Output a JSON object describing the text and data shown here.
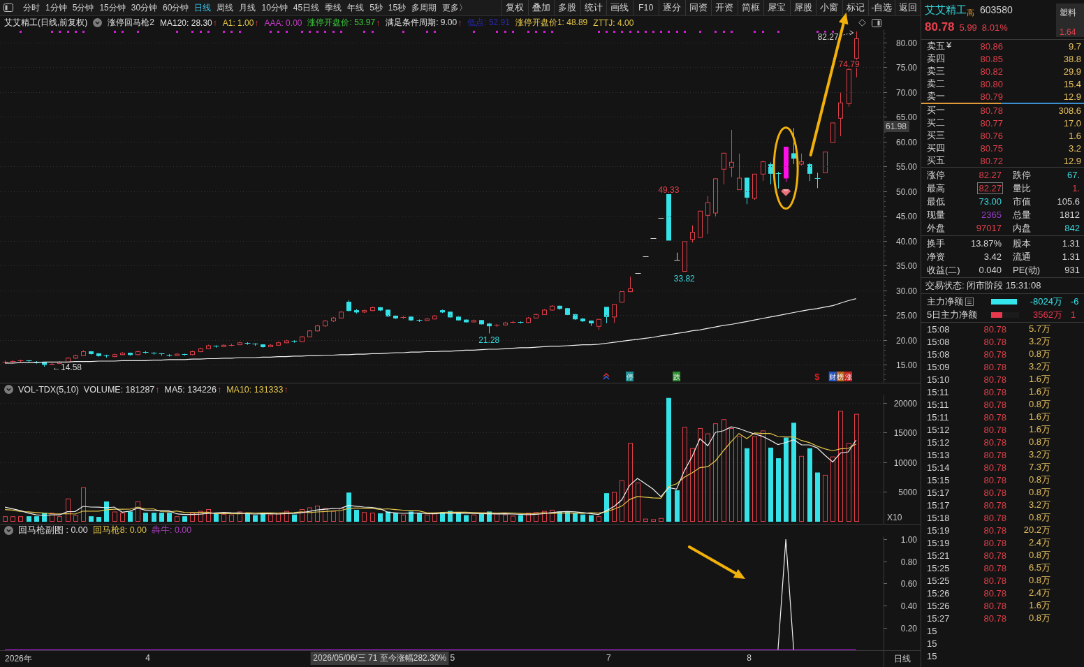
{
  "toolbar": {
    "periods": [
      {
        "label": "分时",
        "selected": false
      },
      {
        "label": "1分钟",
        "selected": false
      },
      {
        "label": "5分钟",
        "selected": false
      },
      {
        "label": "15分钟",
        "selected": false
      },
      {
        "label": "30分钟",
        "selected": false
      },
      {
        "label": "60分钟",
        "selected": false
      },
      {
        "label": "日线",
        "selected": true
      },
      {
        "label": "周线",
        "selected": false
      },
      {
        "label": "月线",
        "selected": false
      },
      {
        "label": "10分钟",
        "selected": false
      },
      {
        "label": "45日线",
        "selected": false
      },
      {
        "label": "季线",
        "selected": false
      },
      {
        "label": "年线",
        "selected": false
      },
      {
        "label": "5秒",
        "selected": false
      },
      {
        "label": "15秒",
        "selected": false
      },
      {
        "label": "多周期",
        "selected": false
      },
      {
        "label": "更多〉",
        "selected": false
      }
    ],
    "buttons": [
      "复权",
      "叠加",
      "多股",
      "统计",
      "画线",
      "F10",
      "逐分",
      "同资",
      "开资",
      "简框",
      "犀宝",
      "犀股",
      "小窗",
      "标记",
      "-自选",
      "返回"
    ]
  },
  "info_bar": {
    "title": "艾艾精工(日线,前复权)",
    "indicator": "涨停回马枪2",
    "values": [
      {
        "text": "MA120: 28.30",
        "arrow": "↑",
        "color": "#e0e0e0"
      },
      {
        "text": "A1: 1.00",
        "arrow": "↑",
        "color": "#e6c84a"
      },
      {
        "text": "AAA: 0.00",
        "color": "#c83cc8"
      },
      {
        "text": "涨停开盘价: 53.97",
        "arrow": "↑",
        "color": "#3cc83c"
      },
      {
        "text": "满足条件周期: 9.00",
        "arrow": "↑",
        "color": "#e0e0e0"
      },
      {
        "text": "低点: 52.91",
        "color": "#2a2ab4"
      },
      {
        "text": "涨停开盘价1: 48.89",
        "color": "#e6c84a"
      },
      {
        "text": "ZTTJ: 4.00",
        "color": "#e6c84a"
      }
    ]
  },
  "price_chart": {
    "price_labels": [
      {
        "text": "49.33",
        "color": "#e0404a"
      },
      {
        "text": "33.82",
        "color": "#3cd6dc"
      },
      {
        "text": "21.28",
        "color": "#3cd6dc"
      },
      {
        "text": "←14.58",
        "color": "#d8d8d8"
      },
      {
        "text": "82.27",
        "color": "#cfcfcf"
      },
      {
        "text": "74.79",
        "color": "#e0404a"
      }
    ],
    "cursor_price": "61.98",
    "events": [
      {
        "kind": "icon"
      },
      {
        "kind": "badge",
        "text": "停",
        "color": "#1f8f94"
      },
      {
        "kind": "badge",
        "text": "跌",
        "color": "#2c8c2c"
      },
      {
        "kind": "glyph",
        "text": "$",
        "color": "#d82020"
      },
      {
        "kind": "badge",
        "text": "财",
        "color": "#2250c0"
      },
      {
        "kind": "badge",
        "text": "榜",
        "color": "#b8641a"
      },
      {
        "kind": "badge",
        "text": "涨",
        "color": "#c42020"
      }
    ],
    "chart_data": {
      "type": "line",
      "grid": true,
      "ylim": [
        11.33,
        82.68
      ],
      "yticks": [
        {
          "value": 15,
          "label": "15.00"
        },
        {
          "value": 20,
          "label": "20.00"
        },
        {
          "value": 25,
          "label": "25.00"
        },
        {
          "value": 30,
          "label": "30.00"
        },
        {
          "value": 35,
          "label": "35.00"
        },
        {
          "value": 40,
          "label": "40.00"
        },
        {
          "value": 45,
          "label": "45.00"
        },
        {
          "value": 50,
          "label": "50.00"
        },
        {
          "value": 55,
          "label": "55.00"
        },
        {
          "value": 60,
          "label": "60.00"
        },
        {
          "value": 65,
          "label": "65.00"
        },
        {
          "value": 70,
          "label": "70.00"
        },
        {
          "value": 75,
          "label": "75.00"
        },
        {
          "value": 80,
          "label": "80.00"
        }
      ],
      "series": [
        {
          "color": "#f0f0f0",
          "values": [
            15.3,
            15.3,
            15.4,
            15.4,
            15.4,
            15.5,
            15.5,
            15.5,
            15.5,
            15.6,
            15.6,
            15.6,
            15.7,
            15.7,
            15.7,
            15.8,
            15.8,
            15.8,
            15.8,
            15.9,
            15.9,
            16.0,
            16.0,
            16.0,
            16.1,
            16.1,
            16.2,
            16.2,
            16.3,
            16.3,
            16.4,
            16.4,
            16.4,
            16.5,
            16.5,
            16.6,
            16.6,
            16.7,
            16.7,
            16.8,
            16.8,
            16.9,
            16.9,
            17.0,
            17.0,
            17.1,
            17.1,
            17.2,
            17.2,
            17.3,
            17.4,
            17.4,
            17.5,
            17.5,
            17.6,
            17.6,
            17.7,
            17.7,
            17.8,
            17.9,
            17.9,
            18.0,
            18.1,
            18.1,
            18.2,
            18.3,
            18.4,
            18.4,
            18.5,
            18.6,
            18.7,
            18.7,
            18.8,
            18.9,
            19.0,
            19.0,
            19.1,
            19.3,
            19.5,
            19.7,
            19.9,
            20.1,
            20.3,
            20.5,
            20.8,
            21.0,
            21.3,
            21.5,
            21.8,
            22.0,
            22.3,
            22.6,
            22.9,
            23.1,
            23.4,
            23.7,
            24.0,
            24.3,
            24.6,
            24.9,
            25.2,
            25.5,
            25.8,
            26.1,
            26.3,
            26.6,
            26.9,
            27.4,
            27.9,
            28.3
          ]
        }
      ]
    }
  },
  "volume_chart": {
    "name": "VOL-TDX(5,10)",
    "values": [
      {
        "text": "VOLUME: 181287",
        "arrow": "↑",
        "color": "#e0e0e0"
      },
      {
        "text": "MA5: 134226",
        "arrow": "↑",
        "color": "#e0e0e0"
      },
      {
        "text": "MA10: 131333",
        "arrow": "↑",
        "color": "#e6c84a"
      }
    ],
    "unit": "X10",
    "chart_data": {
      "type": "bar",
      "grid": true,
      "ylim": [
        0,
        21300
      ],
      "yticks": [
        {
          "value": 5000,
          "label": "5000"
        },
        {
          "value": 10000,
          "label": "10000"
        },
        {
          "value": 15000,
          "label": "15000"
        },
        {
          "value": 20000,
          "label": "20000"
        }
      ],
      "series": [
        {
          "colors": [
            "#e0404a",
            "#e0404a",
            "#e0404a",
            "#35e2e8",
            "#35e2e8",
            "#35e2e8",
            "#e0404a",
            "#e0404a",
            "#e0404a",
            "#e0404a",
            "#e0404a",
            "#35e2e8",
            "#35e2e8",
            "#35e2e8",
            "#e0404a",
            "#e0404a",
            "#35e2e8",
            "#e0404a",
            "#35e2e8",
            "#35e2e8",
            "#35e2e8",
            "#35e2e8",
            "#e0404a",
            "#35e2e8",
            "#e0404a",
            "#e0404a",
            "#e0404a",
            "#35e2e8",
            "#e0404a",
            "#e0404a",
            "#e0404a",
            "#35e2e8",
            "#35e2e8",
            "#35e2e8",
            "#e0404a",
            "#e0404a",
            "#e0404a",
            "#35e2e8",
            "#e0404a",
            "#e0404a",
            "#e0404a",
            "#e0404a",
            "#e0404a",
            "#e0404a",
            "#35e2e8",
            "#35e2e8",
            "#e0404a",
            "#e0404a",
            "#35e2e8",
            "#35e2e8",
            "#35e2e8",
            "#e0404a",
            "#35e2e8",
            "#35e2e8",
            "#e0404a",
            "#e0404a",
            "#35e2e8",
            "#35e2e8",
            "#35e2e8",
            "#35e2e8",
            "#e0404a",
            "#35e2e8",
            "#35e2e8",
            "#e0404a",
            "#e0404a",
            "#e0404a",
            "#35e2e8",
            "#e0404a",
            "#e0404a",
            "#e0404a",
            "#e0404a",
            "#35e2e8",
            "#35e2e8",
            "#35e2e8",
            "#35e2e8",
            "#35e2e8",
            "#e0404a",
            "#35e2e8",
            "#e0404a",
            "#e0404a",
            "#e0404a",
            "#e0404a",
            "#e0404a",
            "#e0404a",
            "#e0404a",
            "#35e2e8",
            "#35e2e8",
            "#e0404a",
            "#e0404a",
            "#e0404a",
            "#e0404a",
            "#e0404a",
            "#e0404a",
            "#e0404a",
            "#e0404a",
            "#35e2e8",
            "#e0404a",
            "#e0404a",
            "#35e2e8",
            "#35e2e8",
            "#35e2e8",
            "#35e2e8",
            "#e0404a",
            "#35e2e8",
            "#35e2e8",
            "#e0404a",
            "#e0404a",
            "#e0404a",
            "#e0404a",
            "#e0404a"
          ],
          "values": [
            800,
            800,
            800,
            800,
            800,
            1400,
            1400,
            800,
            3800,
            1000,
            5700,
            800,
            700,
            3300,
            1600,
            1400,
            1600,
            3300,
            1400,
            1400,
            1400,
            1400,
            800,
            800,
            1400,
            1700,
            2000,
            1300,
            1200,
            1100,
            1600,
            1300,
            1000,
            1400,
            1100,
            1400,
            1700,
            1100,
            2000,
            2300,
            2600,
            2200,
            1700,
            2200,
            4800,
            1900,
            1500,
            1400,
            1300,
            1600,
            1400,
            1100,
            1600,
            1300,
            1100,
            1300,
            1500,
            1700,
            1400,
            1000,
            1100,
            1300,
            1600,
            1300,
            1100,
            900,
            1000,
            1400,
            1500,
            1700,
            1900,
            1600,
            1600,
            1300,
            1100,
            1000,
            800,
            4700,
            4900,
            6900,
            13200,
            6500,
            400,
            300,
            500,
            20800,
            5200,
            15900,
            12300,
            15700,
            14800,
            16500,
            17200,
            15700,
            14300,
            12300,
            14300,
            15300,
            12400,
            10600,
            14100,
            16600,
            11000,
            12300,
            8200,
            7800,
            10900,
            18600,
            13200,
            18100
          ]
        },
        {
          "type": "line",
          "color": "#e6c84a",
          "values": [
            2000,
            1900,
            1650,
            1600,
            1500,
            1400,
            1300,
            1250,
            1300,
            1240,
            1730,
            1730,
            1720,
            1970,
            2050,
            2050,
            2070,
            2420,
            2080,
            2120,
            1650,
            1600,
            1760,
            1510,
            1490,
            1520,
            1560,
            1280,
            1340,
            1310,
            1280,
            1460,
            1400,
            1440,
            1440,
            1400,
            1480,
            1500,
            1620,
            1490,
            1590,
            1680,
            1750,
            1830,
            2200,
            2250,
            2230,
            2200,
            2020,
            2120,
            2000,
            1890,
            1880,
            1790,
            1460,
            1440,
            1520,
            1540,
            1560,
            1540,
            1500,
            1460,
            1440,
            1420,
            1440,
            1400,
            1340,
            1300,
            1340,
            1460,
            1340,
            1400,
            1400,
            1400,
            1340,
            1480,
            1390,
            1600,
            2060,
            2580,
            3710,
            4200,
            4080,
            3980,
            3920,
            5900,
            6340,
            7460,
            8200,
            9080,
            9240,
            10240,
            11920,
            13460,
            14840,
            13990,
            14950,
            14840,
            14850,
            14340,
            14270,
            14280,
            13660,
            13320,
            12710,
            12260,
            11920,
            12250,
            12330,
            13080
          ]
        },
        {
          "type": "line",
          "color": "#f0f0f0",
          "values": [
            2400,
            2100,
            1800,
            1400,
            1100,
            1000,
            1100,
            1100,
            1640,
            1680,
            2540,
            2420,
            2400,
            2300,
            2420,
            1560,
            1720,
            2240,
            1860,
            1820,
            1820,
            1780,
            1280,
            1160,
            1160,
            1220,
            1340,
            1440,
            1520,
            1460,
            1440,
            1300,
            1240,
            1280,
            1280,
            1240,
            1320,
            1340,
            1460,
            1700,
            1940,
            2040,
            2160,
            2200,
            2700,
            2560,
            2420,
            2360,
            2180,
            1540,
            1440,
            1360,
            1400,
            1400,
            1300,
            1280,
            1360,
            1380,
            1400,
            1380,
            1340,
            1300,
            1280,
            1260,
            1280,
            1240,
            1180,
            1140,
            1180,
            1300,
            1500,
            1620,
            1660,
            1620,
            1500,
            1320,
            1160,
            1780,
            2500,
            3660,
            6100,
            7240,
            6380,
            5460,
            4180,
            5700,
            5440,
            8540,
            10940,
            13980,
            12780,
            15040,
            15300,
            15980,
            15700,
            15200,
            14760,
            14380,
            13720,
            12980,
            13340,
            13800,
            12940,
            12920,
            12440,
            11180,
            10040,
            11560,
            11740,
            13720
          ]
        }
      ]
    }
  },
  "indicator_chart": {
    "name": "回马枪副图 : 0.00",
    "values": [
      {
        "text": "回马枪8: 0.00",
        "color": "#e6c84a"
      },
      {
        "text": "犇牛: 0.00",
        "color": "#b040c0"
      }
    ],
    "chart_data": {
      "type": "line",
      "ylim": [
        -0.012,
        1.026
      ],
      "yticks": [
        {
          "value": 0.2,
          "label": "0.20"
        },
        {
          "value": 0.4,
          "label": "0.40"
        },
        {
          "value": 0.6,
          "label": "0.60"
        },
        {
          "value": 0.8,
          "label": "0.80"
        },
        {
          "value": 1.0,
          "label": "1.00"
        }
      ],
      "series": [
        {
          "color": "#a020c8",
          "values": [
            0,
            0,
            0,
            0,
            0,
            0,
            0,
            0,
            0,
            0,
            0,
            0,
            0,
            0,
            0,
            0,
            0,
            0,
            0,
            0,
            0,
            0,
            0,
            0,
            0,
            0,
            0,
            0,
            0,
            0,
            0,
            0,
            0,
            0,
            0,
            0,
            0,
            0,
            0,
            0,
            0,
            0,
            0,
            0,
            0,
            0,
            0,
            0,
            0,
            0,
            0,
            0,
            0,
            0,
            0,
            0,
            0,
            0,
            0,
            0,
            0,
            0,
            0,
            0,
            0,
            0,
            0,
            0,
            0,
            0,
            0,
            0,
            0,
            0,
            0,
            0,
            0,
            0,
            0,
            0,
            0,
            0,
            0,
            0,
            0,
            0,
            0,
            0,
            0,
            0,
            0,
            0,
            0,
            0,
            0,
            0,
            0,
            0,
            0,
            0,
            0,
            0,
            0,
            0,
            0,
            0,
            0,
            0,
            0,
            0
          ]
        },
        {
          "color": "#f0f0f0",
          "values": [
            null,
            null,
            null,
            null,
            null,
            null,
            null,
            null,
            null,
            null,
            null,
            null,
            null,
            null,
            null,
            null,
            null,
            null,
            null,
            null,
            null,
            null,
            null,
            null,
            null,
            null,
            null,
            null,
            null,
            null,
            null,
            null,
            null,
            null,
            null,
            null,
            null,
            null,
            null,
            null,
            null,
            null,
            null,
            null,
            null,
            null,
            null,
            null,
            null,
            null,
            null,
            null,
            null,
            null,
            null,
            null,
            null,
            null,
            null,
            null,
            null,
            null,
            null,
            null,
            null,
            null,
            null,
            null,
            null,
            null,
            null,
            null,
            null,
            null,
            null,
            null,
            null,
            null,
            null,
            null,
            null,
            null,
            null,
            null,
            null,
            null,
            null,
            null,
            null,
            null,
            null,
            null,
            null,
            null,
            null,
            null,
            null,
            null,
            null,
            0,
            1,
            0,
            null,
            null,
            null,
            null,
            null,
            null,
            null,
            null
          ]
        }
      ]
    }
  },
  "date_axis": {
    "labels": [
      "2026年",
      "4",
      "5",
      "7",
      "8"
    ],
    "cursor": "2026/05/06/三 71 至今涨幅282.30%",
    "period": "日线"
  },
  "quote_panel": {
    "name": "艾艾精工",
    "tag": "高",
    "code": "603580",
    "price": "80.78",
    "change": "5.99",
    "change_pct": "8.01%",
    "sector": {
      "name": "塑料",
      "change": "1.64"
    },
    "asks": [
      {
        "label": "卖五",
        "currency": "¥",
        "price": "80.86",
        "volume": "9.7"
      },
      {
        "label": "卖四",
        "price": "80.85",
        "volume": "38.8"
      },
      {
        "label": "卖三",
        "price": "80.82",
        "volume": "29.9"
      },
      {
        "label": "卖二",
        "price": "80.80",
        "volume": "15.4"
      },
      {
        "label": "卖一",
        "price": "80.79",
        "volume": "12.9"
      }
    ],
    "ratio_bar": {
      "level": 0.49
    },
    "bids": [
      {
        "label": "买一",
        "price": "80.78",
        "volume": "308.6"
      },
      {
        "label": "买二",
        "price": "80.77",
        "volume": "17.0"
      },
      {
        "label": "买三",
        "price": "80.76",
        "volume": "1.6"
      },
      {
        "label": "买四",
        "price": "80.75",
        "volume": "3.2"
      },
      {
        "label": "买五",
        "price": "80.72",
        "volume": "12.9"
      }
    ],
    "stats": [
      {
        "label": "涨停",
        "value": "82.27",
        "color": "#e0404a",
        "highlighted": false
      },
      {
        "label": "跌停",
        "value": "67.",
        "color": "#3cd6dc",
        "highlighted": false
      },
      {
        "label": "最高",
        "value": "82.27",
        "color": "#e0404a",
        "highlighted": true
      },
      {
        "label": "量比",
        "value": "1.",
        "color": "#e0404a",
        "highlighted": false
      },
      {
        "label": "最低",
        "value": "73.00",
        "color": "#3cd6dc",
        "highlighted": false
      },
      {
        "label": "市值",
        "value": "105.6",
        "color": "#d6d6d6",
        "highlighted": false
      },
      {
        "label": "现量",
        "value": "2365",
        "color": "#9a3cc8",
        "highlighted": false
      },
      {
        "label": "总量",
        "value": "1812",
        "color": "#d6d6d6",
        "highlighted": false
      },
      {
        "label": "外盘",
        "value": "97017",
        "color": "#e0404a",
        "highlighted": false
      },
      {
        "label": "内盘",
        "value": "842",
        "color": "#3cd6dc",
        "highlighted": false
      }
    ],
    "fundamentals": [
      {
        "label": "换手",
        "value": "13.87%"
      },
      {
        "label": "股本",
        "value": "1.31"
      },
      {
        "label": "净资",
        "value": "3.42"
      },
      {
        "label": "流通",
        "value": "1.31"
      },
      {
        "label": "收益(二)",
        "value": "0.040"
      },
      {
        "label": "PE(动)",
        "value": "931"
      }
    ],
    "trade_status": "交易状态: 闭市阶段 15:31:08",
    "money_flow": [
      {
        "label": "主力净额",
        "detail_icon": true,
        "level": 0.93,
        "color": "#35e6ec",
        "value": "-8024万",
        "extra": "-6"
      },
      {
        "label": "5日主力净额",
        "detail_icon": false,
        "level": 0.41,
        "color": "#e8384e",
        "value": "3562万",
        "extra": "1"
      }
    ],
    "ticks": [
      {
        "time": "15:08",
        "price": "80.78",
        "volume": "5.7万"
      },
      {
        "time": "15:08",
        "price": "80.78",
        "volume": "3.2万"
      },
      {
        "time": "15:08",
        "price": "80.78",
        "volume": "0.8万"
      },
      {
        "time": "15:09",
        "price": "80.78",
        "volume": "3.2万"
      },
      {
        "time": "15:10",
        "price": "80.78",
        "volume": "1.6万"
      },
      {
        "time": "15:11",
        "price": "80.78",
        "volume": "1.6万"
      },
      {
        "time": "15:11",
        "price": "80.78",
        "volume": "0.8万"
      },
      {
        "time": "15:11",
        "price": "80.78",
        "volume": "1.6万"
      },
      {
        "time": "15:12",
        "price": "80.78",
        "volume": "1.6万"
      },
      {
        "time": "15:12",
        "price": "80.78",
        "volume": "0.8万"
      },
      {
        "time": "15:13",
        "price": "80.78",
        "volume": "3.2万"
      },
      {
        "time": "15:14",
        "price": "80.78",
        "volume": "7.3万"
      },
      {
        "time": "15:15",
        "price": "80.78",
        "volume": "0.8万"
      },
      {
        "time": "15:17",
        "price": "80.78",
        "volume": "0.8万"
      },
      {
        "time": "15:17",
        "price": "80.78",
        "volume": "3.2万"
      },
      {
        "time": "15:18",
        "price": "80.78",
        "volume": "0.8万"
      },
      {
        "time": "15:19",
        "price": "80.78",
        "volume": "20.2万"
      },
      {
        "time": "15:19",
        "price": "80.78",
        "volume": "2.4万"
      },
      {
        "time": "15:21",
        "price": "80.78",
        "volume": "0.8万"
      },
      {
        "time": "15:25",
        "price": "80.78",
        "volume": "6.5万"
      },
      {
        "time": "15:25",
        "price": "80.78",
        "volume": "0.8万"
      },
      {
        "time": "15:26",
        "price": "80.78",
        "volume": "2.4万"
      },
      {
        "time": "15:26",
        "price": "80.78",
        "volume": "1.6万"
      },
      {
        "time": "15:27",
        "price": "80.78",
        "volume": "0.8万"
      },
      {
        "time": "15"
      },
      {
        "time": "15"
      },
      {
        "time": "15"
      }
    ]
  }
}
